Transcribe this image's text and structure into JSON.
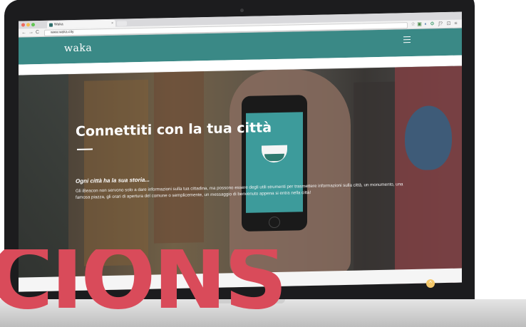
{
  "browser": {
    "tab_title": "Waka",
    "tab_close": "×",
    "url": "www.waka.city",
    "nav_back": "←",
    "nav_forward": "→",
    "nav_reload": "C",
    "ext_icons": [
      "☆",
      "▣",
      "◐",
      "⚙",
      "∫?",
      "⊡",
      "≡"
    ]
  },
  "site": {
    "logo": "waka",
    "hero_title": "Connettiti con la tua città",
    "hero_subtitle": "Ogni città ha la sua storia...",
    "hero_body": "Gli iBeacon non servono solo a dare informazioni sulla tua cittadina, ma possono essere degli utili strumenti per trasmettere informazioni sulla città, un monumento, una famosa piazza, gli orari di apertura del comune o semplicemente, un messaggio di benvenuto appena si entra nella città!",
    "scroll_up": "^"
  },
  "overlay": {
    "big_word": "CIONS"
  },
  "colors": {
    "brand_teal": "#3a8986",
    "accent_red": "#d94b5a"
  }
}
